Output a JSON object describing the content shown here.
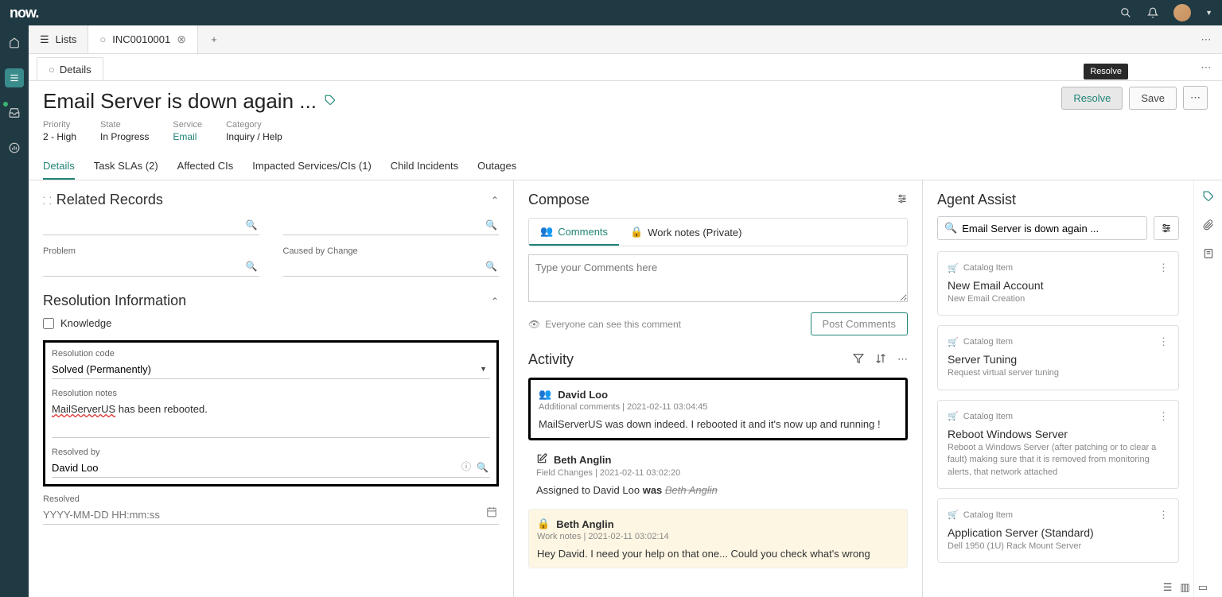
{
  "topbar": {
    "logo": "now."
  },
  "tabs": {
    "lists": "Lists",
    "record": "INC0010001"
  },
  "subtab": {
    "details": "Details"
  },
  "header": {
    "title": "Email Server is down again ...",
    "actions": {
      "resolve": "Resolve",
      "save": "Save"
    },
    "tooltip": "Resolve",
    "meta": {
      "priority_label": "Priority",
      "priority_value": "2 - High",
      "state_label": "State",
      "state_value": "In Progress",
      "service_label": "Service",
      "service_value": "Email",
      "category_label": "Category",
      "category_value": "Inquiry / Help"
    }
  },
  "nav": {
    "details": "Details",
    "task_slas": "Task SLAs (2)",
    "affected_cis": "Affected CIs",
    "impacted": "Impacted Services/CIs (1)",
    "child": "Child Incidents",
    "outages": "Outages"
  },
  "related": {
    "title": "Related Records",
    "problem_label": "Problem",
    "caused_label": "Caused by Change"
  },
  "resolution": {
    "title": "Resolution Information",
    "knowledge_label": "Knowledge",
    "code_label": "Resolution code",
    "code_value": "Solved (Permanently)",
    "notes_label": "Resolution notes",
    "notes_underlined": "MailServerUS",
    "notes_rest": " has been rebooted.",
    "resolved_by_label": "Resolved by",
    "resolved_by_value": "David Loo",
    "resolved_label": "Resolved",
    "resolved_placeholder": "YYYY-MM-DD HH:mm:ss"
  },
  "compose": {
    "title": "Compose",
    "comments_tab": "Comments",
    "worknotes_tab": "Work notes (Private)",
    "placeholder": "Type your Comments here",
    "visibility": "Everyone can see this comment",
    "post": "Post Comments"
  },
  "activity": {
    "title": "Activity",
    "items": [
      {
        "author": "David Loo",
        "meta": "Additional comments | 2021-02-11 03:04:45",
        "body": "MailServerUS was down indeed. I rebooted it and it's now up and running !"
      },
      {
        "author": "Beth Anglin",
        "meta": "Field Changes | 2021-02-11 03:02:20",
        "body_prefix": "Assigned to   David Loo ",
        "body_was": "was ",
        "body_strike": "Beth Anglin"
      },
      {
        "author": "Beth Anglin",
        "meta": "Work notes | 2021-02-11 03:02:14",
        "body": "Hey David. I need your help on that one... Could you check what's wrong"
      }
    ]
  },
  "assist": {
    "title": "Agent Assist",
    "search": "Email Server is down again ...",
    "cards": [
      {
        "type": "Catalog Item",
        "title": "New Email Account",
        "desc": "New Email Creation"
      },
      {
        "type": "Catalog Item",
        "title": "Server Tuning",
        "desc": "Request virtual server tuning"
      },
      {
        "type": "Catalog Item",
        "title": "Reboot Windows Server",
        "desc": "Reboot a Windows Server (after patching or to clear a fault) making sure that it is removed from monitoring alerts, that network attached"
      },
      {
        "type": "Catalog Item",
        "title": "Application Server (Standard)",
        "desc": "Dell 1950 (1U) Rack Mount Server"
      }
    ]
  }
}
